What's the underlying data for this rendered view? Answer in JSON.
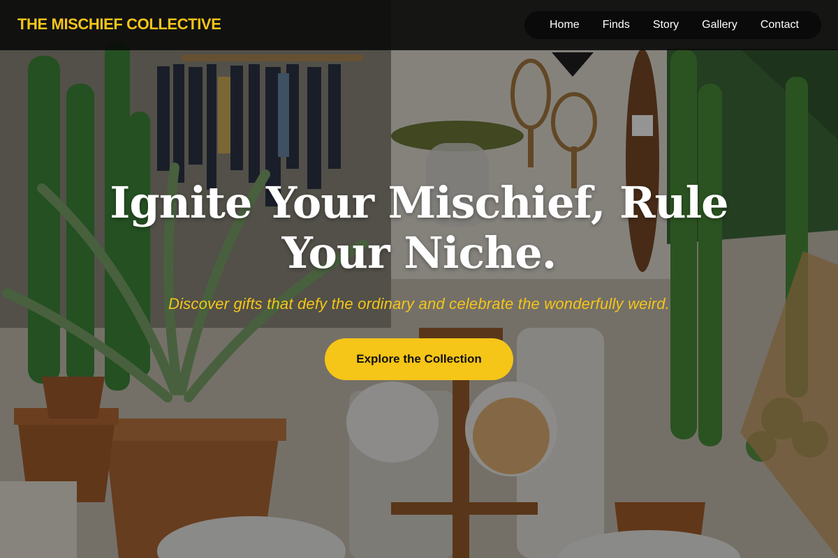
{
  "colors": {
    "accent": "#f5c518",
    "nav_background": "#0a0a0a",
    "text_light": "#ffffff"
  },
  "brand": {
    "name": "THE MISCHIEF COLLECTIVE"
  },
  "nav": {
    "items": [
      {
        "label": "Home"
      },
      {
        "label": "Finds"
      },
      {
        "label": "Story"
      },
      {
        "label": "Gallery"
      },
      {
        "label": "Contact"
      }
    ]
  },
  "hero": {
    "title": "Ignite Your Mischief, Rule Your Niche.",
    "subtitle": "Discover gifts that defy the ordinary and celebrate the wonderfully weird.",
    "cta_label": "Explore the Collection",
    "background_image": "shop interior with potted cacti, succulents, clothing rack, wooden rackets and mugs on a mug tree"
  }
}
